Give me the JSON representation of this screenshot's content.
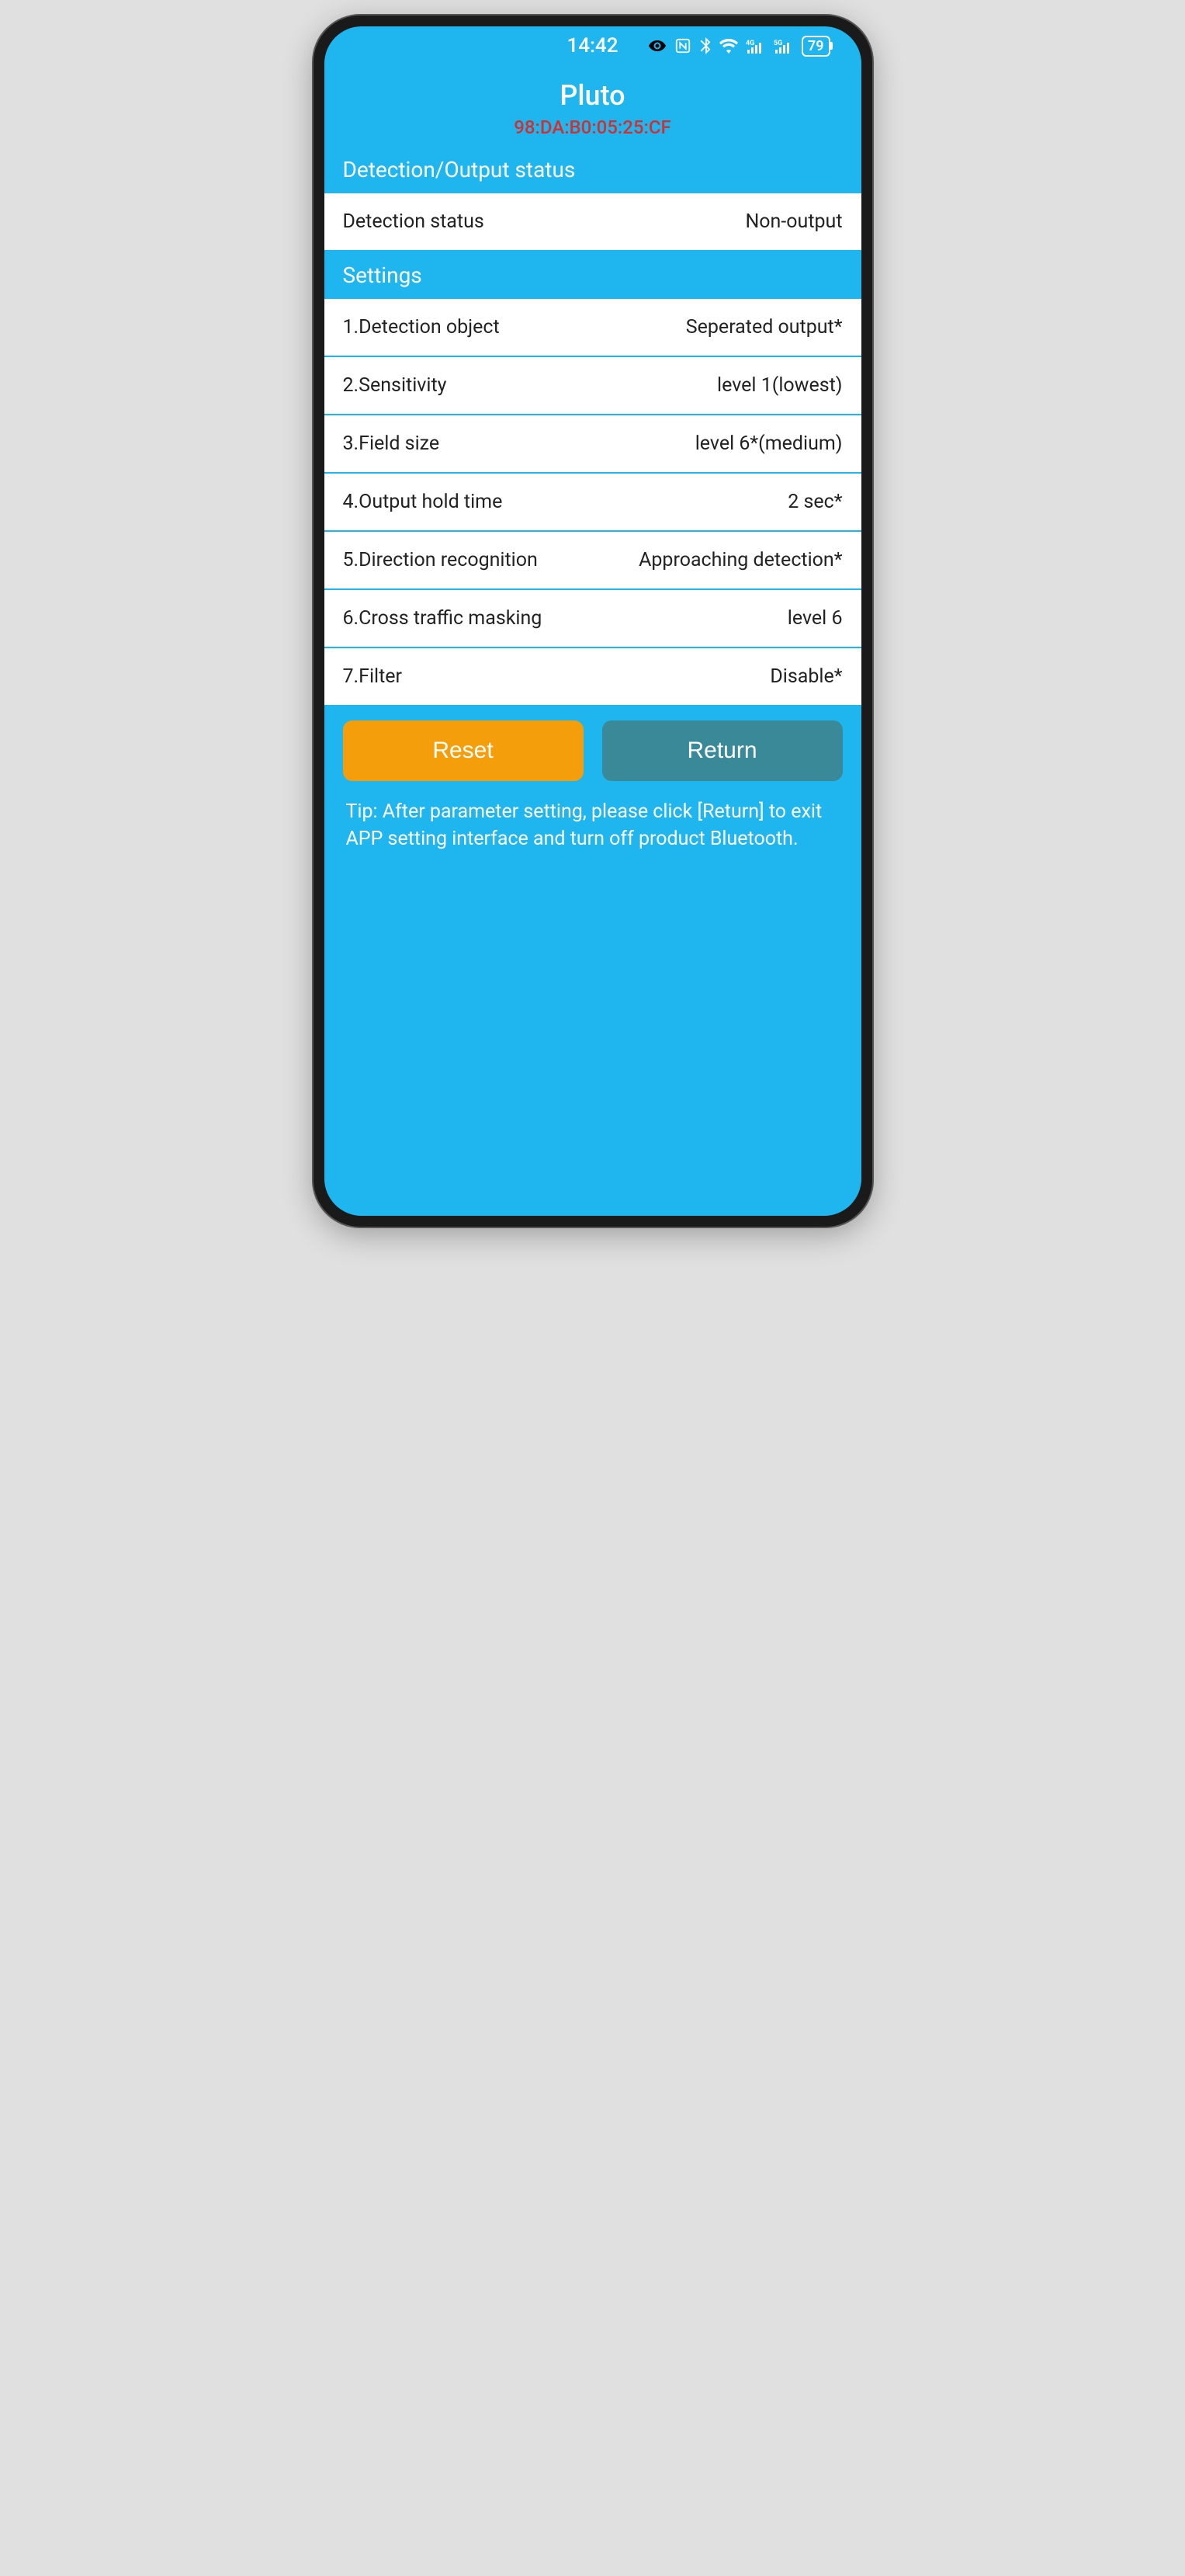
{
  "status_bar": {
    "time": "14:42",
    "battery": "79"
  },
  "header": {
    "title": "Pluto",
    "mac": "98:DA:B0:05:25:CF"
  },
  "detection_section": {
    "label": "Detection/Output status",
    "row_label": "Detection status",
    "row_value": "Non-output"
  },
  "settings_section": {
    "label": "Settings",
    "items": [
      {
        "label": "1.Detection object",
        "value": "Seperated output*"
      },
      {
        "label": "2.Sensitivity",
        "value": "level 1(lowest)"
      },
      {
        "label": "3.Field size",
        "value": "level 6*(medium)"
      },
      {
        "label": "4.Output hold time",
        "value": "2 sec*"
      },
      {
        "label": "5.Direction recognition",
        "value": "Approaching detection*"
      },
      {
        "label": "6.Cross traffic masking",
        "value": "level 6"
      },
      {
        "label": "7.Filter",
        "value": "Disable*"
      }
    ]
  },
  "buttons": {
    "reset": "Reset",
    "return": "Return"
  },
  "tip": "Tip: After parameter setting, please click [Return] to exit APP setting interface and turn off product Bluetooth."
}
